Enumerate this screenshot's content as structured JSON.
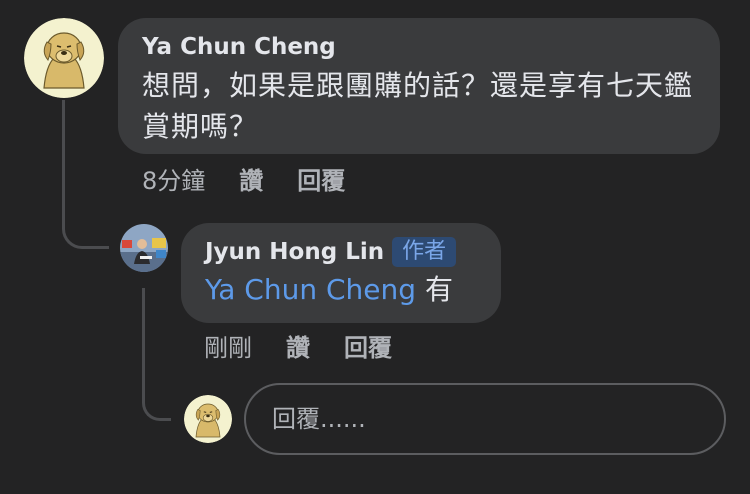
{
  "comments": [
    {
      "author": "Ya Chun Cheng",
      "text": "想問，如果是跟團購的話？還是享有七天鑑賞期嗎？",
      "timestamp": "8分鐘",
      "like_label": "讚",
      "reply_label": "回覆",
      "avatar_icon": "dog-avatar-icon"
    },
    {
      "author": "Jyun Hong Lin",
      "badge": "作者",
      "mention": "Ya Chun Cheng",
      "text": "有",
      "timestamp": "剛剛",
      "like_label": "讚",
      "reply_label": "回覆",
      "avatar_icon": "user-photo-avatar-icon"
    }
  ],
  "compose": {
    "placeholder": "回覆......",
    "value": "",
    "avatar_icon": "dog-avatar-icon"
  },
  "colors": {
    "background": "#232324",
    "bubble": "#3a3b3d",
    "text": "#e4e6eb",
    "secondary_text": "#b0b3b8",
    "mention": "#5d9ae9",
    "badge_bg": "#2d4a73",
    "badge_text": "#7aa6e8"
  }
}
